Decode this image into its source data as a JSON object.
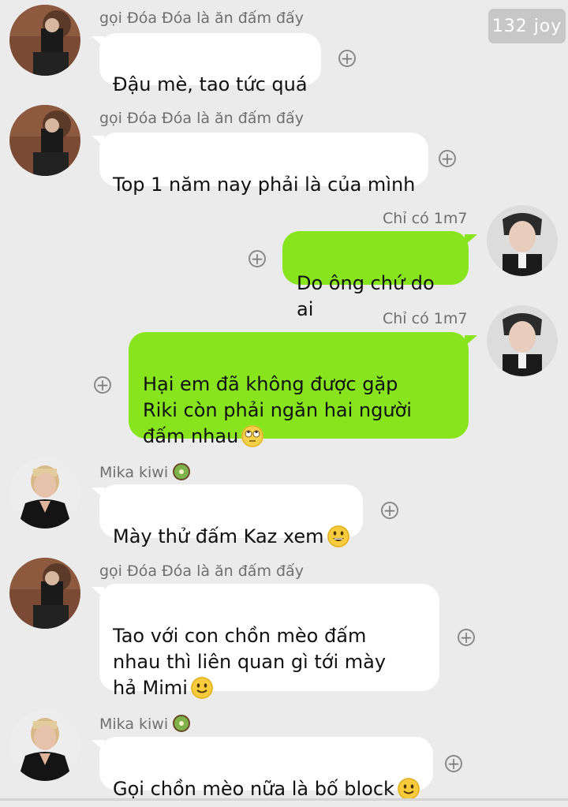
{
  "header": {
    "badge_text": "132 joy"
  },
  "messages": [
    {
      "sender": "gọi Đóa Đóa là ăn đấm đấy",
      "text": "Đậu mè, tao tức quá",
      "emoji": "",
      "direction": "in"
    },
    {
      "sender": "gọi Đóa Đóa là ăn đấm đấy",
      "text": "Top 1 năm nay phải là của mình",
      "emoji": "",
      "direction": "in"
    },
    {
      "sender": "Chỉ có 1m7",
      "text": "Do ông chứ do ai",
      "emoji": "",
      "direction": "out"
    },
    {
      "sender": "Chỉ có 1m7",
      "text": "Hại em đã không được gặp\nRiki còn phải ngăn hai người\nđấm nhau",
      "emoji": "face-with-rolling-eyes",
      "direction": "out"
    },
    {
      "sender": "Mika kiwi",
      "text": "Mày thử đấm Kaz xem",
      "emoji": "grinning-face",
      "direction": "in"
    },
    {
      "sender": "gọi Đóa Đóa là ăn đấm đấy",
      "text": "Tao với con chồn mèo đấm\nnhau thì liên quan gì tới mày\nhả Mimi",
      "emoji": "slightly-smiling-face",
      "direction": "in"
    },
    {
      "sender": "Mika kiwi",
      "text": "Gọi chồn mèo nữa là bố block",
      "emoji": "slightly-smiling-face",
      "direction": "in"
    }
  ],
  "icons": {
    "add_reaction": "plus-circle-icon",
    "sender_badge": "kiwi-icon"
  },
  "colors": {
    "background": "#ebebeb",
    "incoming_bubble": "#ffffff",
    "outgoing_bubble": "#88e41c",
    "sender_text": "#6f6f6f"
  }
}
